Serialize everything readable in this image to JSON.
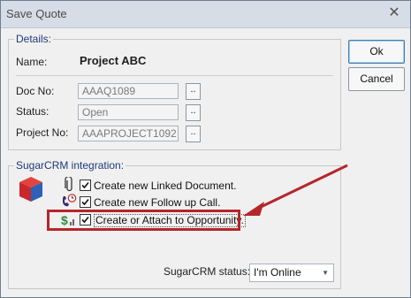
{
  "window": {
    "title": "Save Quote"
  },
  "details": {
    "legend": "Details:",
    "name_label": "Name:",
    "name_value": "Project ABC",
    "doc_no_label": "Doc No:",
    "doc_no_value": "AAAQ1089",
    "status_label": "Status:",
    "status_value": "Open",
    "project_no_label": "Project No:",
    "project_no_value": "AAAPROJECT1092",
    "browse_label": ".."
  },
  "buttons": {
    "ok": "Ok",
    "cancel": "Cancel"
  },
  "sugar": {
    "legend": "SugarCRM integration:",
    "opt_linked_doc": "Create new Linked Document.",
    "opt_follow_up": "Create new Follow up Call.",
    "opt_opportunity": "Create or Attach to Opportunity.",
    "status_label": "SugarCRM status:",
    "status_value": "I'm Online",
    "checked": [
      true,
      true,
      true
    ]
  },
  "colors": {
    "highlight": "#b5262b",
    "arrow": "#b5262b",
    "legend_text": "#1e3a7a"
  }
}
